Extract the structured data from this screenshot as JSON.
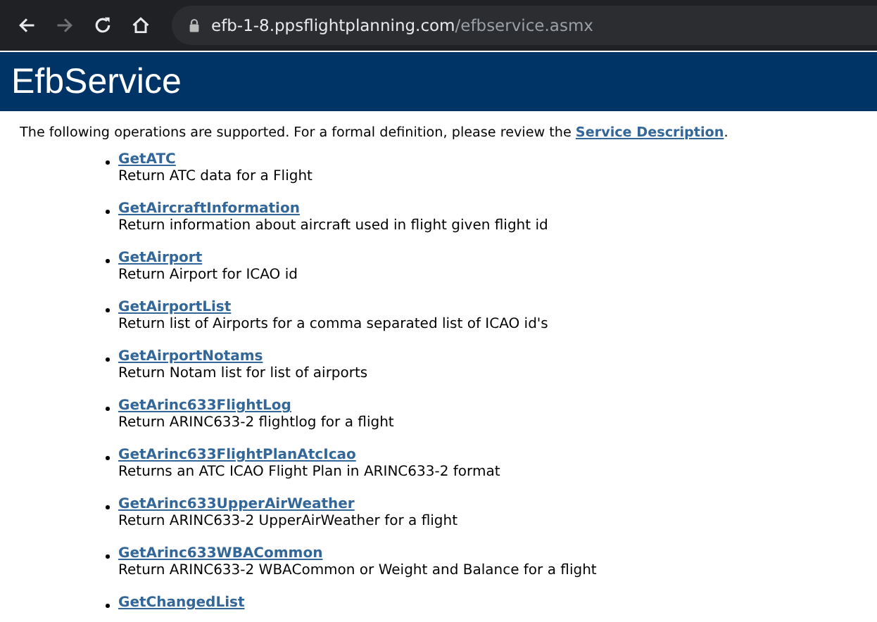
{
  "browser": {
    "nav_buttons": [
      {
        "kind": "back",
        "disabled": false
      },
      {
        "kind": "forward",
        "disabled": true
      },
      {
        "kind": "reload",
        "disabled": false
      },
      {
        "kind": "home",
        "disabled": false
      }
    ],
    "address": {
      "host": "efb-1-8.ppsflightplanning.com",
      "path": "/efbservice.asmx"
    }
  },
  "header": {
    "title": "EfbService"
  },
  "intro": {
    "text": "The following operations are supported. For a formal definition, please review the ",
    "link": "Service Description",
    "end": "."
  },
  "operations": [
    {
      "name": "GetATC",
      "description": "Return ATC data for a Flight"
    },
    {
      "name": "GetAircraftInformation",
      "description": "Return information about aircraft used in flight given flight id"
    },
    {
      "name": "GetAirport",
      "description": "Return Airport for ICAO id"
    },
    {
      "name": "GetAirportList",
      "description": "Return list of Airports for a comma separated list of ICAO id's"
    },
    {
      "name": "GetAirportNotams",
      "description": "Return Notam list for list of airports"
    },
    {
      "name": "GetArinc633FlightLog",
      "description": "Return ARINC633-2 flightlog for a flight"
    },
    {
      "name": "GetArinc633FlightPlanAtcIcao",
      "description": "Returns an ATC ICAO Flight Plan in ARINC633-2 format"
    },
    {
      "name": "GetArinc633UpperAirWeather",
      "description": "Return ARINC633-2 UpperAirWeather for a flight"
    },
    {
      "name": "GetArinc633WBACommon",
      "description": "Return ARINC633-2 WBACommon or Weight and Balance for a flight"
    },
    {
      "name": "GetChangedList"
    }
  ]
}
